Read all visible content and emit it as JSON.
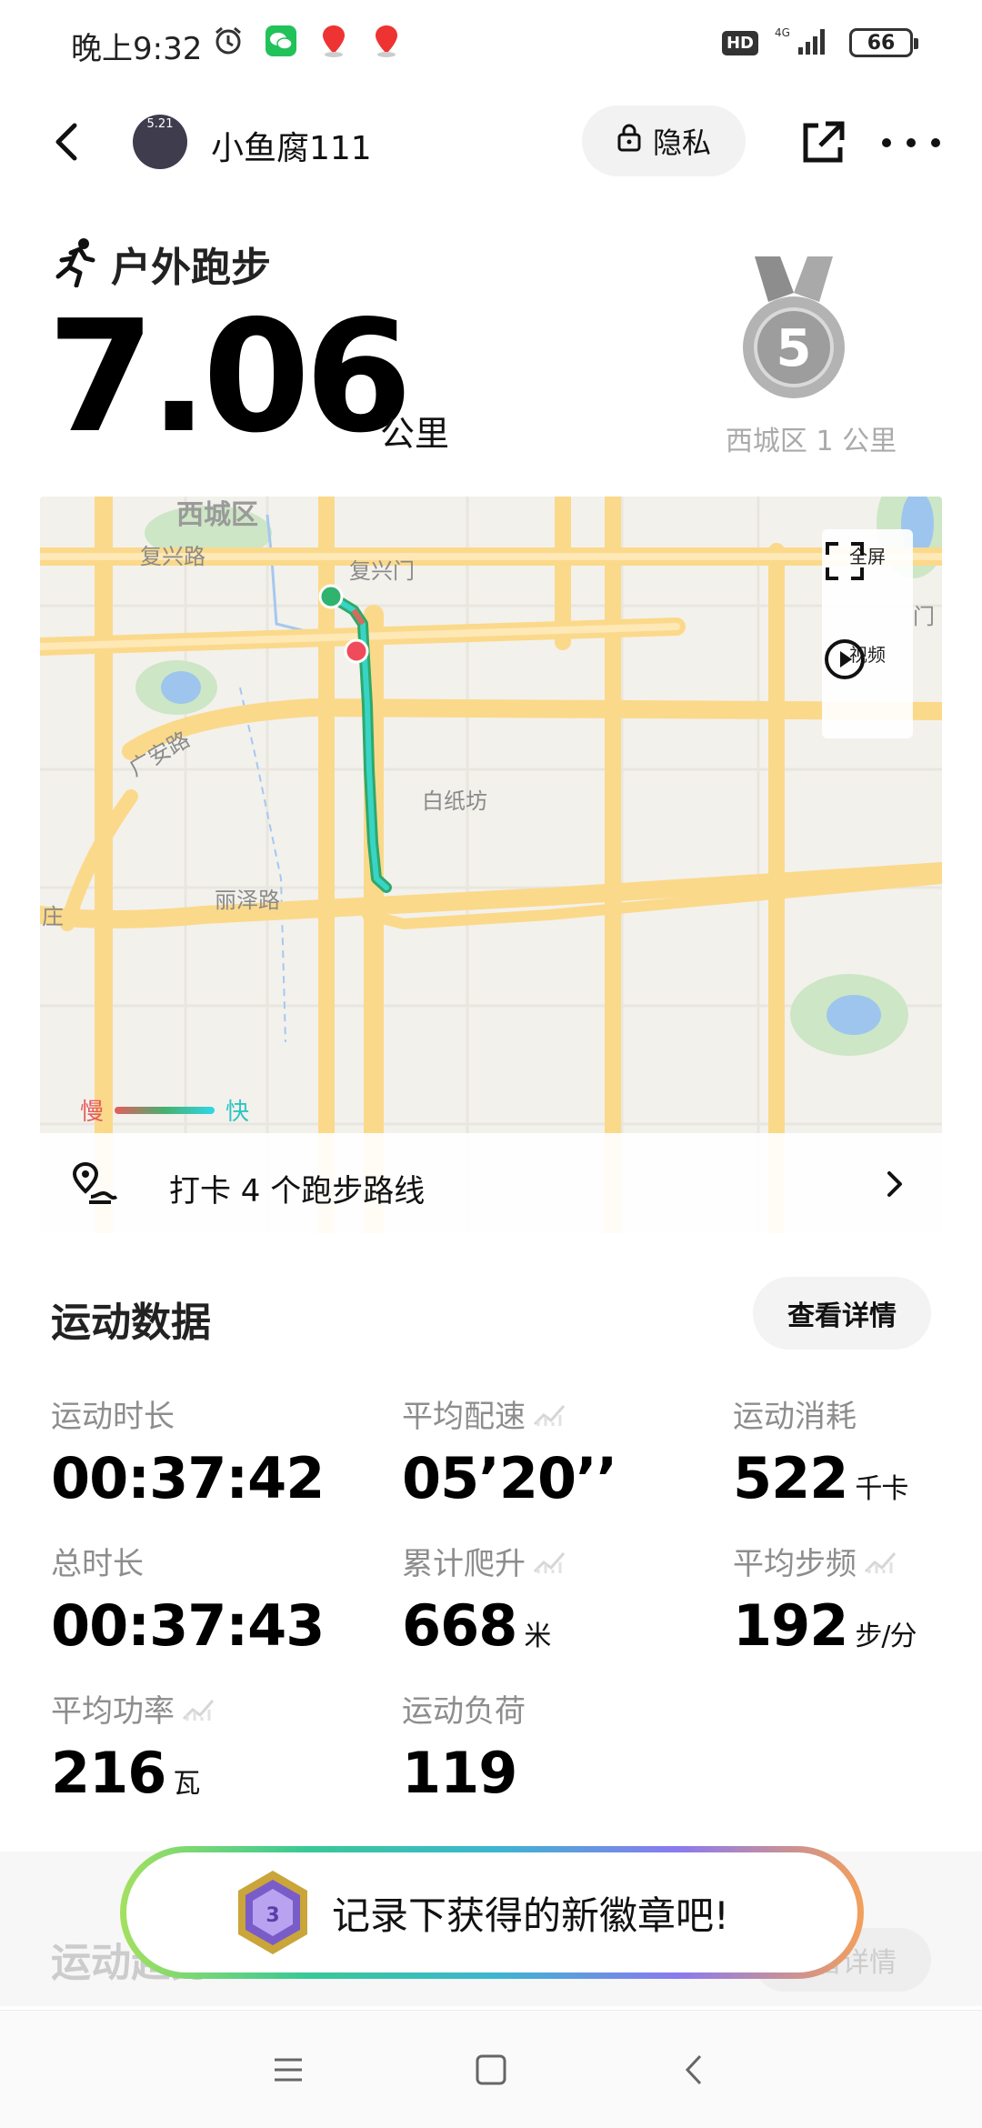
{
  "status_bar": {
    "time": "晚上9:32",
    "hd": "HD",
    "signal": "4G",
    "battery": "66"
  },
  "header": {
    "username": "小鱼腐111",
    "avatar_text": "5.21",
    "privacy_label": "隐私"
  },
  "workout": {
    "type": "户外跑步",
    "distance": "7.06",
    "distance_unit": "公里",
    "medal_number": "5",
    "medal_caption": "西城区 1 公里"
  },
  "map": {
    "labels": {
      "district": "西城区",
      "road1": "复兴路",
      "place1": "复兴门",
      "road2": "广安路",
      "place2": "白纸坊",
      "road3": "丽泽路",
      "edge1": "门",
      "edge2": "庄"
    },
    "fullscreen_label": "全屏",
    "video_label": "视频",
    "speed_slow": "慢",
    "speed_fast": "快",
    "checkin_text": "打卡 4 个跑步路线"
  },
  "stats": {
    "title": "运动数据",
    "detail_button": "查看详情",
    "items": [
      {
        "label": "运动时长",
        "value": "00:37:42",
        "unit": "",
        "trend": false
      },
      {
        "label": "平均配速",
        "value": "05’20’’",
        "unit": "",
        "trend": true
      },
      {
        "label": "运动消耗",
        "value": "522",
        "unit": "千卡",
        "trend": false
      },
      {
        "label": "总时长",
        "value": "00:37:43",
        "unit": "",
        "trend": false
      },
      {
        "label": "累计爬升",
        "value": "668",
        "unit": "米",
        "trend": true
      },
      {
        "label": "平均步频",
        "value": "192",
        "unit": "步/分",
        "trend": true
      },
      {
        "label": "平均功率",
        "value": "216",
        "unit": "瓦",
        "trend": true
      },
      {
        "label": "运动负荷",
        "value": "119",
        "unit": "",
        "trend": false
      }
    ]
  },
  "next_section": {
    "title": "运动趋势",
    "detail_button": "查看详情"
  },
  "badge_toast": {
    "text": "记录下获得的新徽章吧!"
  },
  "colors": {
    "route_start": "#2fb36f",
    "route_end": "#ef4b5a",
    "route_line": "#35c7b8",
    "road_major": "#fbd98a",
    "map_bg": "#f3f1ec"
  }
}
